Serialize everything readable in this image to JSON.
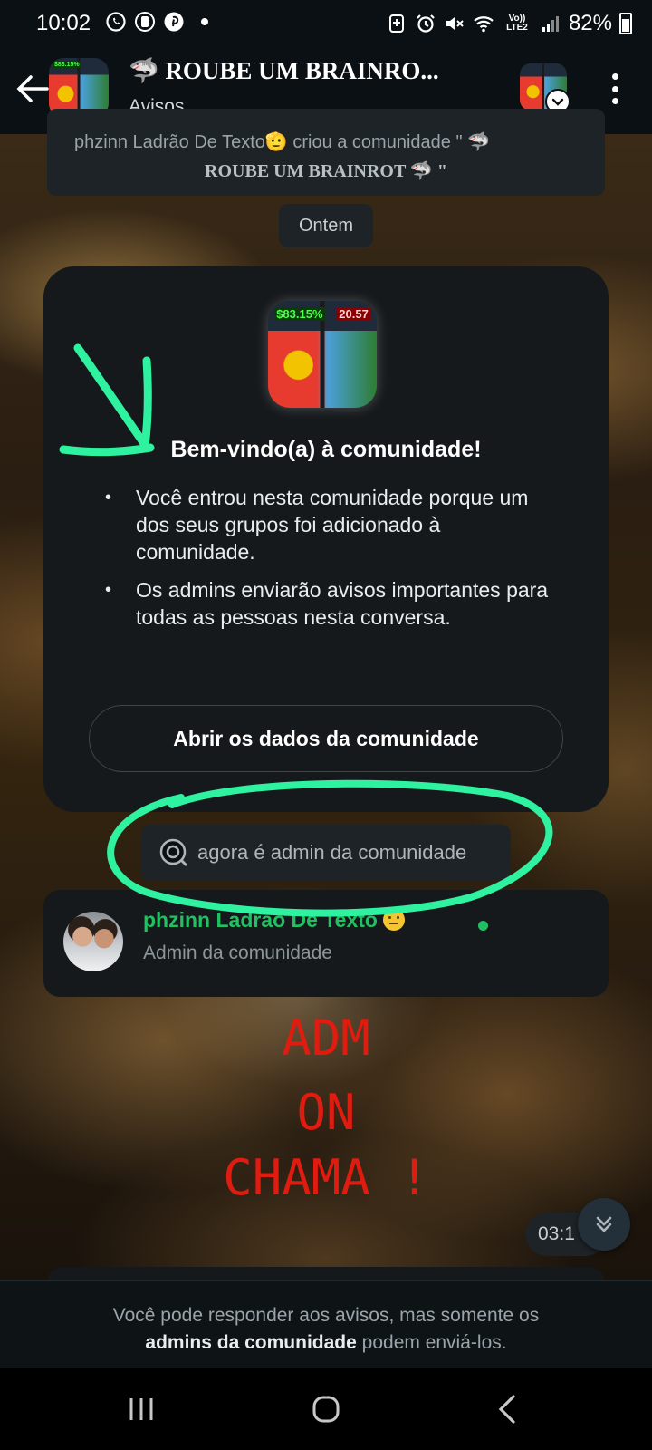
{
  "status_bar": {
    "time": "10:02",
    "battery": "82%",
    "network": "Vo)) LTE2"
  },
  "header": {
    "title": "🦈 ROUBE UM BRAINRO...",
    "subtitle": "Avisos"
  },
  "thumbnail": {
    "badge_left": "$83.15%",
    "badge_right": "20.57"
  },
  "previous_message": {
    "line1": "phzinn Ladrão De Texto🫡 criou a comunidade \" 🦈",
    "line2": "ROUBE UM BRAINROT 🦈 \""
  },
  "date_chip": "Ontem",
  "welcome_card": {
    "title": "Bem-vindo(a) à comunidade!",
    "bullets": [
      "Você entrou nesta comunidade porque um dos seus grupos foi adicionado à comunidade.",
      "Os admins enviarão avisos importantes para todas as pessoas nesta conversa."
    ],
    "button_label": "Abrir os dados da comunidade"
  },
  "system_message": "agora é admin da comunidade",
  "admin_card": {
    "name": "phzinn Ladrão De Texto",
    "role": "Admin da comunidade"
  },
  "annotation_text": [
    "ADM",
    "ON",
    "CHAMA !"
  ],
  "message_time": "03:1",
  "footer": {
    "text_before": "Você pode responder aos avisos, mas somente os",
    "bold": "admins da comunidade",
    "text_after": "podem enviá-los."
  },
  "colors": {
    "accent_green": "#21c063",
    "annotation_green": "#2ef2a0",
    "annotation_red": "#e01b10",
    "card_bg": "#15191c",
    "chip_bg": "#1d2326"
  },
  "icons": [
    "whatsapp-icon",
    "notification-icon",
    "pinterest-icon",
    "battery-saver-icon",
    "alarm-icon",
    "mute-icon",
    "wifi-icon",
    "signal-icon",
    "back-arrow-icon",
    "chevron-down-icon",
    "more-vert-icon",
    "scroll-down-icon",
    "recents-icon",
    "home-icon",
    "nav-back-icon"
  ]
}
